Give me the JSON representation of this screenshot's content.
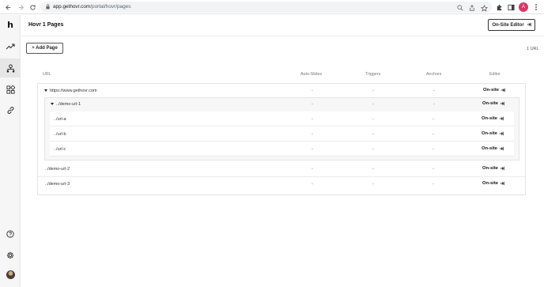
{
  "browser": {
    "url_host": "app.gethovr.com",
    "url_path": "/portal/hovr/pages",
    "profile_initial": "A"
  },
  "header": {
    "title": "Hovr 1 Pages",
    "editor_button": "On-Site Editor"
  },
  "toolbar": {
    "add_page": "+ Add Page",
    "url_count": "1 URL"
  },
  "table": {
    "columns": [
      "URL",
      "Auto-Slides",
      "Triggers",
      "Anchors",
      "Editor"
    ],
    "rows": [
      {
        "url": "https://www.gethovr.com",
        "auto_slides": "-",
        "triggers": "-",
        "anchors": "-",
        "editor": "On-site"
      },
      {
        "url": "../demo-url-1",
        "auto_slides": "-",
        "triggers": "-",
        "anchors": "-",
        "editor": "On-site"
      },
      {
        "url": "../url-a",
        "auto_slides": "-",
        "triggers": "-",
        "anchors": "-",
        "editor": "On-site"
      },
      {
        "url": "../url-b",
        "auto_slides": "-",
        "triggers": "-",
        "anchors": "-",
        "editor": "On-site"
      },
      {
        "url": "../url-c",
        "auto_slides": "-",
        "triggers": "-",
        "anchors": "-",
        "editor": "On-site"
      },
      {
        "url": "../demo-url-2",
        "auto_slides": "-",
        "triggers": "-",
        "anchors": "-",
        "editor": "On-site"
      },
      {
        "url": "../demo-url-3",
        "auto_slides": "-",
        "triggers": "-",
        "anchors": "-",
        "editor": "On-site"
      }
    ]
  },
  "icons": {
    "rail": [
      "logo",
      "trending-icon",
      "hierarchy-icon",
      "widgets-icon",
      "link-icon",
      "help-icon",
      "settings-icon",
      "user-avatar"
    ]
  },
  "colors": {
    "accent": "#111111",
    "rail_bg": "#f6f6f6",
    "profile": "#d93668"
  }
}
